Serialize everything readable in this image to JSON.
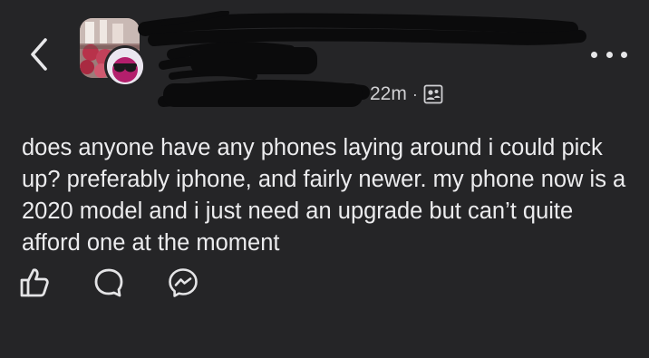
{
  "post": {
    "timestamp": "22m",
    "separator": "·",
    "privacy_icon": "group-members-icon",
    "text": "does anyone have any phones laying around i could pick up? preferably iphone, and fairly newer. my phone now is a 2020 model and i just need an upgrade but can’t quite afford one at the moment"
  },
  "header": {
    "back_icon": "chevron-left-icon",
    "more_icon": "more-options-icon"
  },
  "actions": {
    "like_icon": "thumbs-up-icon",
    "comment_icon": "comment-bubble-icon",
    "share_icon": "messenger-icon"
  },
  "colors": {
    "background": "#252527",
    "text": "#ececee",
    "icon": "#e4e4e6"
  }
}
